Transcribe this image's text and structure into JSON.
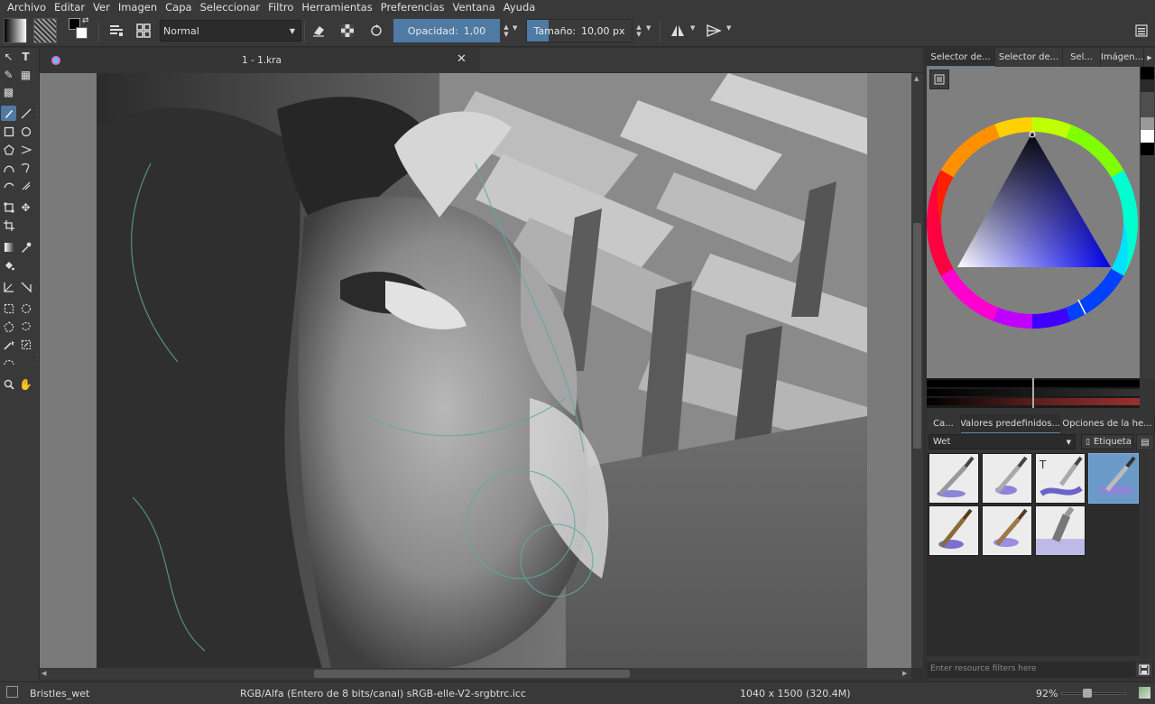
{
  "menu": [
    "Archivo",
    "Editar",
    "Ver",
    "Imagen",
    "Capa",
    "Seleccionar",
    "Filtro",
    "Herramientas",
    "Preferencias",
    "Ventana",
    "Ayuda"
  ],
  "toolbar": {
    "blend_mode": "Normal",
    "opacity_label": "Opacidad:",
    "opacity_value": "1,00",
    "size_label": "Tamaño:",
    "size_value": "10,00 px"
  },
  "document": {
    "tab_title": "1 - 1.kra"
  },
  "dock": {
    "top_tabs": [
      "Selector de...",
      "Selector de...",
      "Sel...",
      "Imágen..."
    ],
    "bottom_tabs": [
      "Ca...",
      "Valores predefinidos...",
      "Opciones de la he..."
    ],
    "preset_filter_value": "Wet",
    "tag_label": "Etiqueta",
    "resource_filter_placeholder": "Enter resource filters here"
  },
  "status": {
    "brush_preset": "Bristles_wet",
    "color_space": "RGB/Alfa (Entero de 8 bits/canal)  sRGB-elle-V2-srgbtrc.icc",
    "image_size": "1040 x 1500 (320.4M)",
    "zoom": "92%"
  },
  "colors": {
    "accent": "#4f7aa3",
    "background": "#313131"
  },
  "icons": {
    "doc_close": "close-icon",
    "color_menu": "list-icon",
    "save_filter": "save-icon"
  }
}
